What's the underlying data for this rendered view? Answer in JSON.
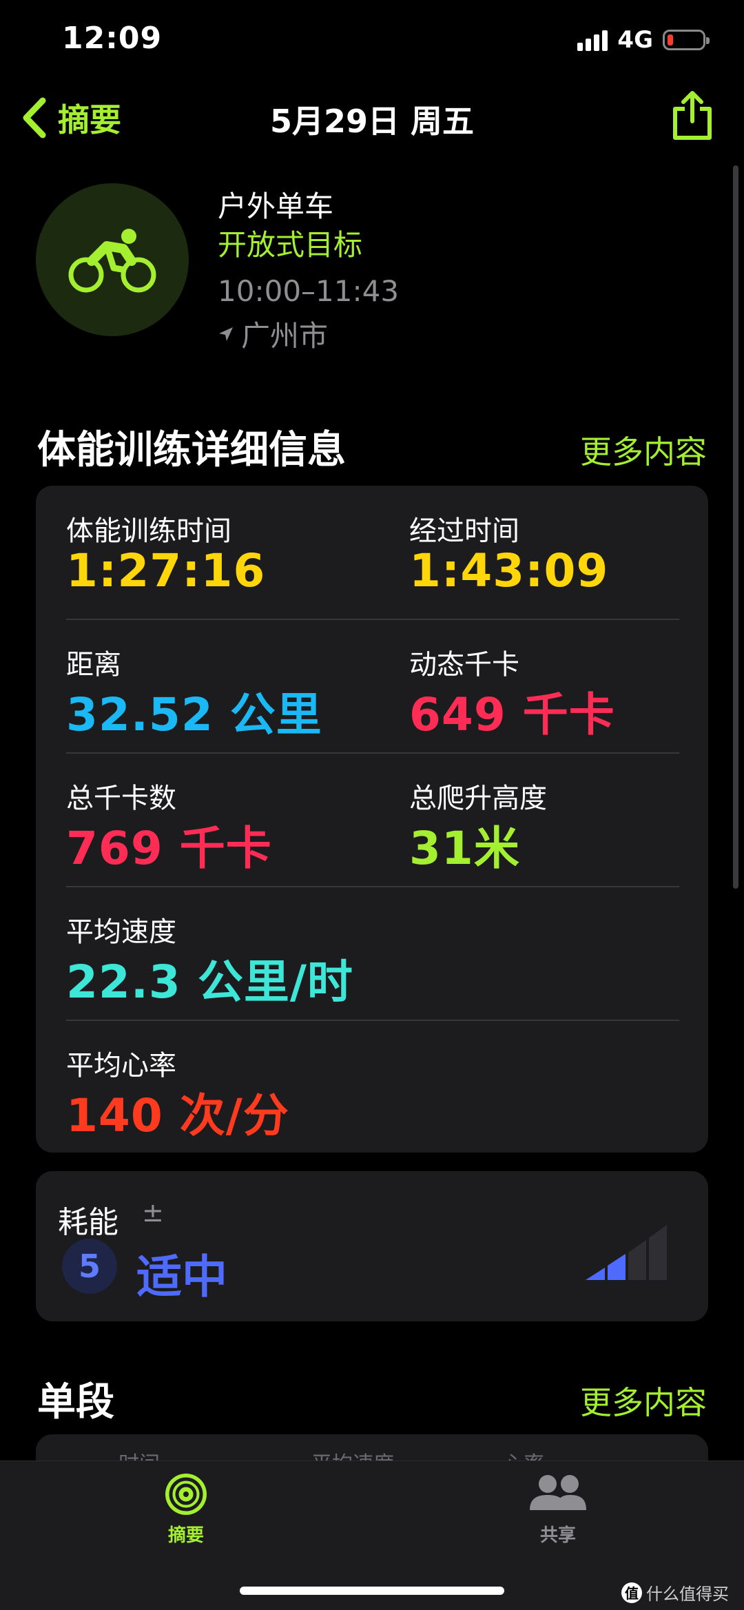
{
  "status": {
    "time": "12:09",
    "network": "4G"
  },
  "nav": {
    "back_label": "摘要",
    "title": "5月29日 周五"
  },
  "workout": {
    "type": "户外单车",
    "goal": "开放式目标",
    "time_range": "10:00–11:43",
    "location": "广州市"
  },
  "details": {
    "title": "体能训练详细信息",
    "more": "更多内容",
    "metrics": [
      {
        "label": "体能训练时间",
        "value": "1:27:16",
        "color": "#ffd60a"
      },
      {
        "label": "经过时间",
        "value": "1:43:09",
        "color": "#ffd60a"
      },
      {
        "label": "距离",
        "value": "32.52 公里",
        "color": "#1ab8f5"
      },
      {
        "label": "动态千卡",
        "value": "649 千卡",
        "color": "#ff2d55"
      },
      {
        "label": "总千卡数",
        "value": "769 千卡",
        "color": "#ff2d55"
      },
      {
        "label": "总爬升高度",
        "value": "31米",
        "color": "#a4ef2f"
      },
      {
        "label": "平均速度",
        "value": "22.3 公里/时",
        "color": "#3ee6d8"
      },
      {
        "label": "平均心率",
        "value": "140 次/分",
        "color": "#ff3b1f"
      }
    ]
  },
  "effort": {
    "label": "耗能",
    "adjust": "±",
    "score": "5",
    "value": "适中",
    "level": 2,
    "max_level": 4
  },
  "splits": {
    "title": "单段",
    "more": "更多内容",
    "columns": [
      "时间",
      "平均速度",
      "心率"
    ]
  },
  "tabs": [
    {
      "label": "摘要",
      "active": true
    },
    {
      "label": "共享",
      "active": false
    }
  ],
  "watermark": {
    "text": "什么值得买",
    "badge": "值"
  }
}
